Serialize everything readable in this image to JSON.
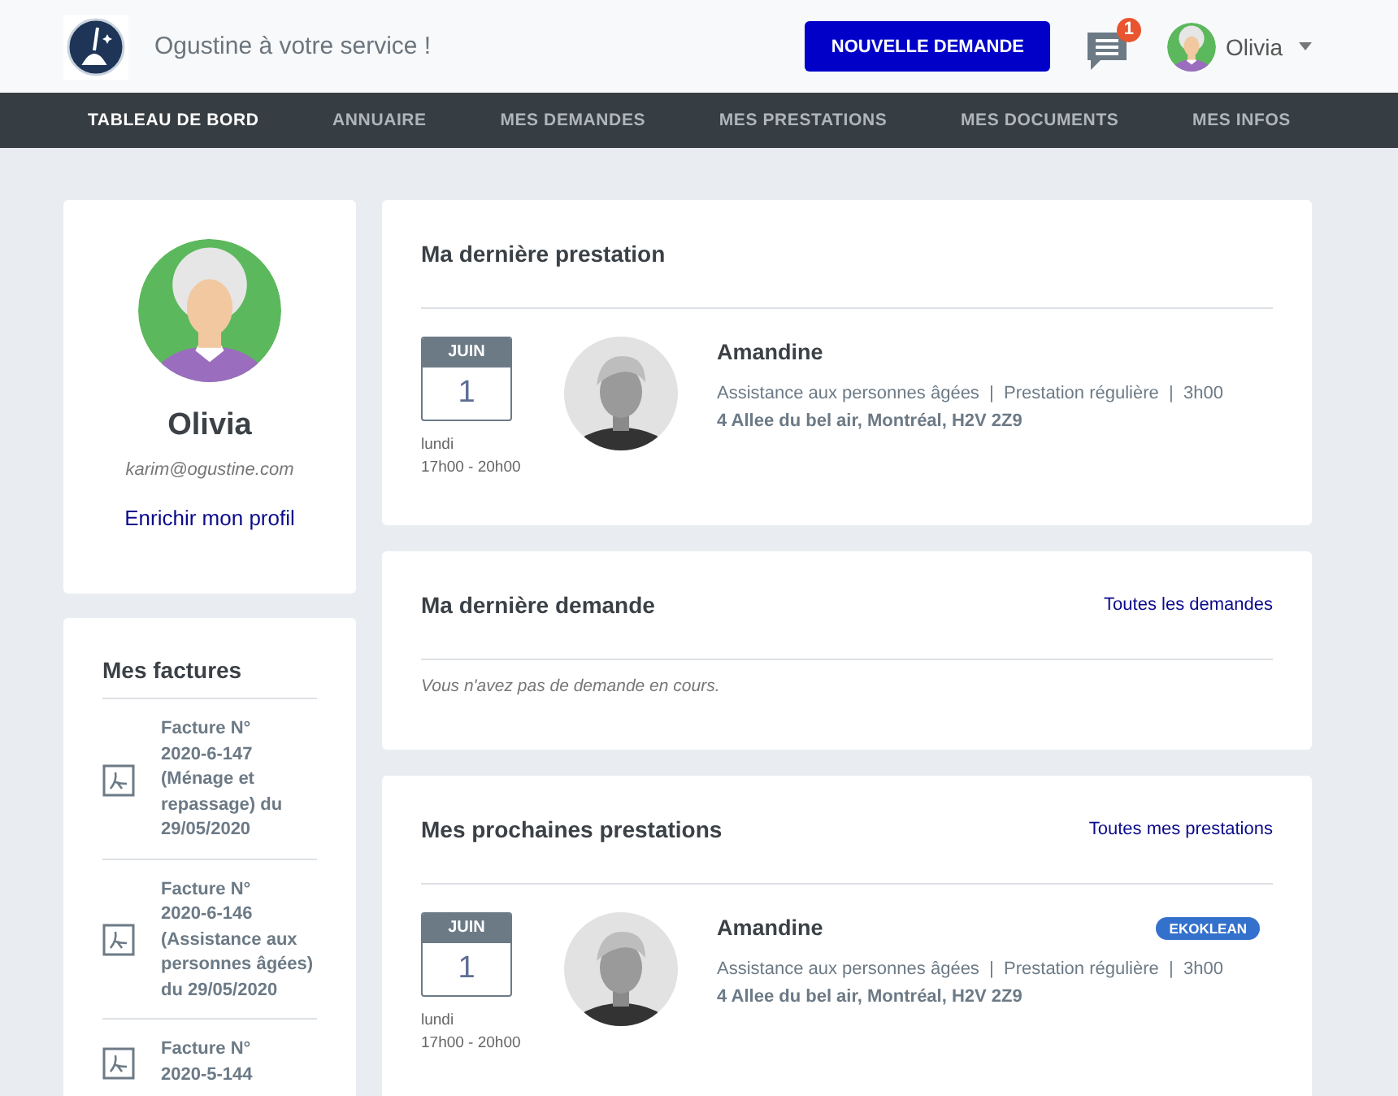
{
  "header": {
    "tagline": "Ogustine à votre service !",
    "new_request_button": "NOUVELLE DEMANDE",
    "notification_count": "1",
    "user_name": "Olivia"
  },
  "nav": [
    {
      "label": "TABLEAU DE BORD",
      "selected": true
    },
    {
      "label": "ANNUAIRE",
      "selected": false
    },
    {
      "label": "MES DEMANDES",
      "selected": false
    },
    {
      "label": "MES PRESTATIONS",
      "selected": false
    },
    {
      "label": "MES DOCUMENTS",
      "selected": false
    },
    {
      "label": "MES INFOS",
      "selected": false
    }
  ],
  "profile": {
    "name": "Olivia",
    "email": "karim@ogustine.com",
    "link": "Enrichir mon profil"
  },
  "invoices": {
    "title": "Mes factures",
    "items": [
      {
        "text": "Facture N° 2020-6-147 (Ménage et repassage) du 29/05/2020"
      },
      {
        "text": "Facture N° 2020-6-146 (Assistance aux personnes âgées) du 29/05/2020"
      },
      {
        "text": "Facture N° 2020-5-144"
      }
    ]
  },
  "last_service": {
    "title": "Ma dernière prestation",
    "services": [
      {
        "month": "JUIN",
        "day": "1",
        "weekday": "lundi",
        "hours": "17h00 - 20h00",
        "name": "Amandine",
        "details": "Assistance aux personnes âgées  |  Prestation régulière  |  3h00",
        "address": "4 Allee du bel air, Montréal, H2V 2Z9"
      }
    ]
  },
  "last_request": {
    "title": "Ma dernière demande",
    "link": "Toutes les demandes",
    "empty_message": "Vous n'avez pas de demande en cours."
  },
  "upcoming": {
    "title": "Mes prochaines prestations",
    "link": "Toutes mes prestations",
    "services": [
      {
        "month": "JUIN",
        "day": "1",
        "weekday": "lundi",
        "hours": "17h00 - 20h00",
        "name": "Amandine",
        "badge": "EKOKLEAN",
        "details": "Assistance aux personnes âgées  |  Prestation régulière  |  3h00",
        "address": "4 Allee du bel air, Montréal, H2V 2Z9"
      }
    ]
  }
}
